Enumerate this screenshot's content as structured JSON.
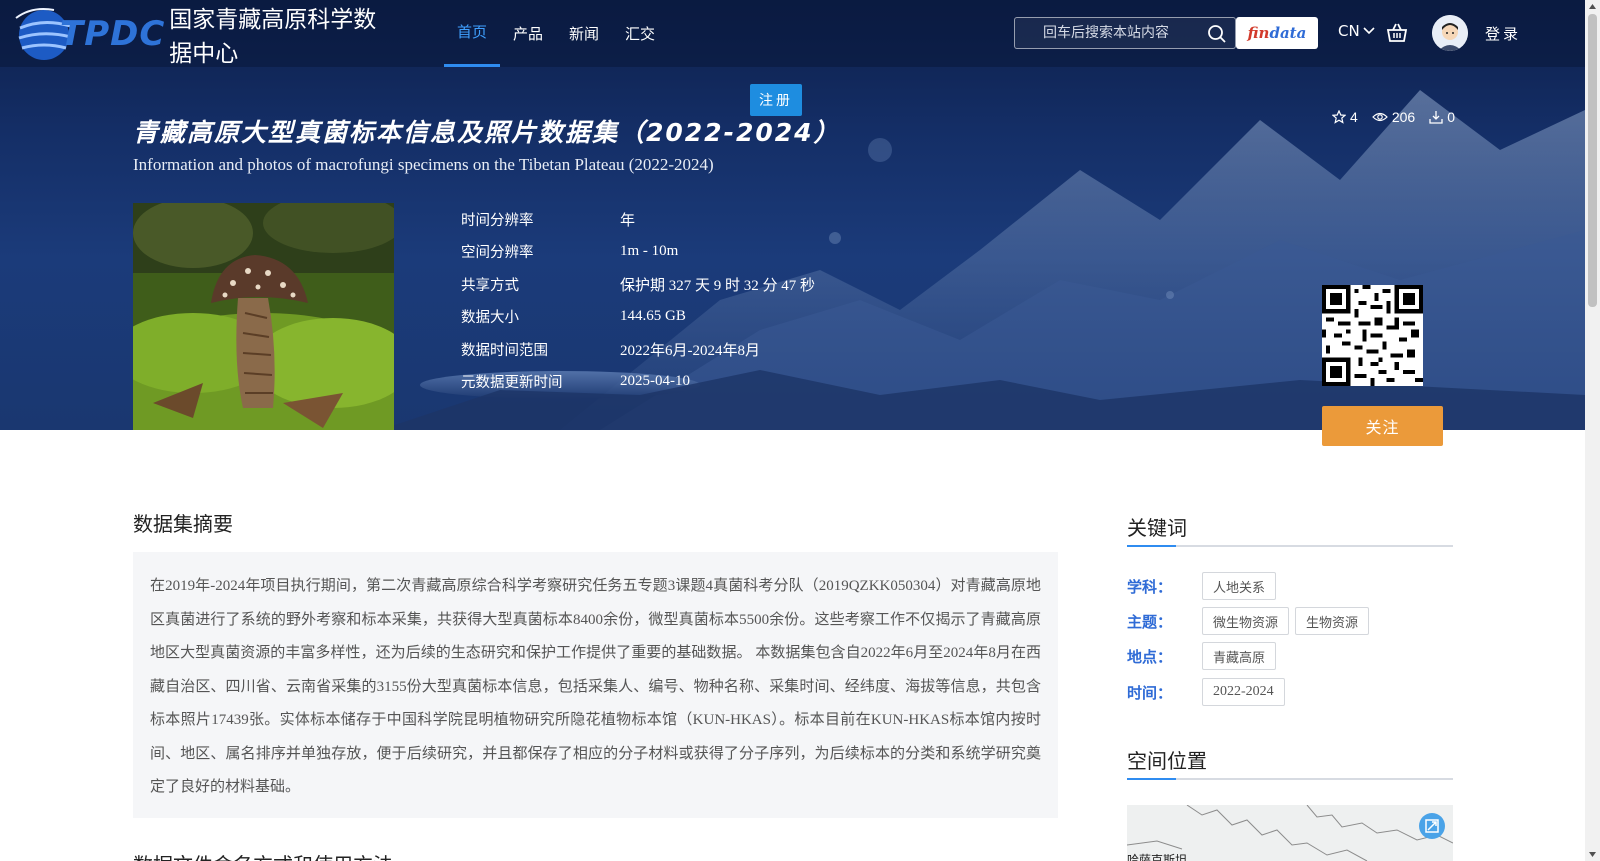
{
  "header": {
    "logo_abbr": "TPDC",
    "logo_name": "国家青藏高原科学数据中心",
    "nav": [
      {
        "label": "首页",
        "active": true
      },
      {
        "label": "产品",
        "active": false
      },
      {
        "label": "新闻",
        "active": false
      },
      {
        "label": "汇交",
        "active": false
      }
    ],
    "search_placeholder": "回车后搜索本站内容",
    "findata_part1": "fin",
    "findata_part2": "data",
    "lang": "CN",
    "login": "登录"
  },
  "register_label": "注册",
  "dataset": {
    "title_cn": "青藏高原大型真菌标本信息及照片数据集（2022-2024）",
    "title_en": "Information and photos of macrofungi specimens on the Tibetan Plateau (2022-2024)",
    "stats": {
      "stars": "4",
      "views": "206",
      "downloads": "0"
    },
    "meta": [
      {
        "label": "时间分辨率",
        "value": "年"
      },
      {
        "label": "空间分辨率",
        "value": "1m - 10m"
      },
      {
        "label": "共享方式",
        "value": "保护期 327 天 9 时 32 分 47 秒"
      },
      {
        "label": "数据大小",
        "value": "144.65 GB"
      },
      {
        "label": "数据时间范围",
        "value": "2022年6月-2024年8月"
      },
      {
        "label": "元数据更新时间",
        "value": "2025-04-10"
      }
    ],
    "follow_label": "关注"
  },
  "summary": {
    "title": "数据集摘要",
    "text": "在2019年-2024年项目执行期间，第二次青藏高原综合科学考察研究任务五专题3课题4真菌科考分队（2019QZKK050304）对青藏高原地区真菌进行了系统的野外考察和标本采集，共获得大型真菌标本8400余份，微型真菌标本5500余份。这些考察工作不仅揭示了青藏高原地区大型真菌资源的丰富多样性，还为后续的生态研究和保护工作提供了重要的基础数据。 本数据集包含自2022年6月至2024年8月在西藏自治区、四川省、云南省采集的3155份大型真菌标本信息，包括采集人、编号、物种名称、采集时间、经纬度、海拔等信息，共包含标本照片17439张。实体标本储存于中国科学院昆明植物研究所隐花植物标本馆（KUN-HKAS）。标本目前在KUN-HKAS标本馆内按时间、地区、属名排序并单独存放，便于后续研究，并且都保存了相应的分子材料或获得了分子序列，为后续标本的分类和系统学研究奠定了良好的材料基础。"
  },
  "next_section_title": "数据文件命名方式和使用方法",
  "keywords": {
    "title": "关键词",
    "rows": [
      {
        "label": "学科：",
        "tags": [
          "人地关系"
        ]
      },
      {
        "label": "主题：",
        "tags": [
          "微生物资源",
          "生物资源"
        ]
      },
      {
        "label": "地点：",
        "tags": [
          "青藏高原"
        ]
      },
      {
        "label": "时间：",
        "tags": [
          "2022-2024"
        ]
      }
    ]
  },
  "location": {
    "title": "空间位置",
    "map_label": "哈萨克斯坦"
  }
}
